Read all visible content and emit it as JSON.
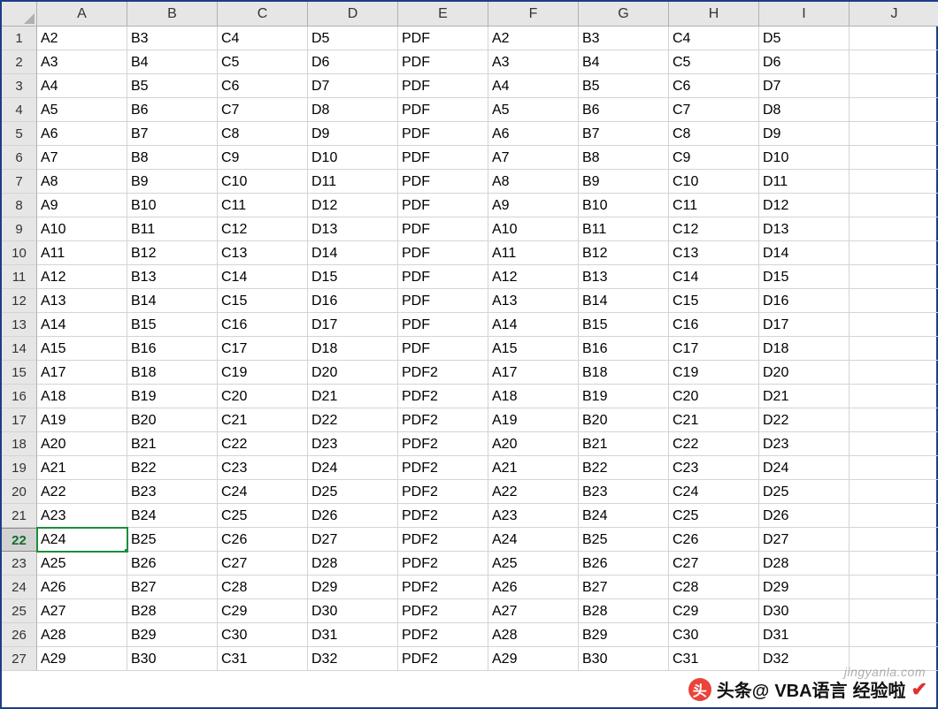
{
  "columns": [
    "A",
    "B",
    "C",
    "D",
    "E",
    "F",
    "G",
    "H",
    "I",
    "J"
  ],
  "row_numbers": [
    1,
    2,
    3,
    4,
    5,
    6,
    7,
    8,
    9,
    10,
    11,
    12,
    13,
    14,
    15,
    16,
    17,
    18,
    19,
    20,
    21,
    22,
    23,
    24,
    25,
    26,
    27
  ],
  "selected_row": 22,
  "selected_col": 0,
  "rows": [
    [
      "A2",
      "B3",
      "C4",
      "D5",
      "PDF",
      "A2",
      "B3",
      "C4",
      "D5",
      ""
    ],
    [
      "A3",
      "B4",
      "C5",
      "D6",
      "PDF",
      "A3",
      "B4",
      "C5",
      "D6",
      ""
    ],
    [
      "A4",
      "B5",
      "C6",
      "D7",
      "PDF",
      "A4",
      "B5",
      "C6",
      "D7",
      ""
    ],
    [
      "A5",
      "B6",
      "C7",
      "D8",
      "PDF",
      "A5",
      "B6",
      "C7",
      "D8",
      ""
    ],
    [
      "A6",
      "B7",
      "C8",
      "D9",
      "PDF",
      "A6",
      "B7",
      "C8",
      "D9",
      ""
    ],
    [
      "A7",
      "B8",
      "C9",
      "D10",
      "PDF",
      "A7",
      "B8",
      "C9",
      "D10",
      ""
    ],
    [
      "A8",
      "B9",
      "C10",
      "D11",
      "PDF",
      "A8",
      "B9",
      "C10",
      "D11",
      ""
    ],
    [
      "A9",
      "B10",
      "C11",
      "D12",
      "PDF",
      "A9",
      "B10",
      "C11",
      "D12",
      ""
    ],
    [
      "A10",
      "B11",
      "C12",
      "D13",
      "PDF",
      "A10",
      "B11",
      "C12",
      "D13",
      ""
    ],
    [
      "A11",
      "B12",
      "C13",
      "D14",
      "PDF",
      "A11",
      "B12",
      "C13",
      "D14",
      ""
    ],
    [
      "A12",
      "B13",
      "C14",
      "D15",
      "PDF",
      "A12",
      "B13",
      "C14",
      "D15",
      ""
    ],
    [
      "A13",
      "B14",
      "C15",
      "D16",
      "PDF",
      "A13",
      "B14",
      "C15",
      "D16",
      ""
    ],
    [
      "A14",
      "B15",
      "C16",
      "D17",
      "PDF",
      "A14",
      "B15",
      "C16",
      "D17",
      ""
    ],
    [
      "A15",
      "B16",
      "C17",
      "D18",
      "PDF",
      "A15",
      "B16",
      "C17",
      "D18",
      ""
    ],
    [
      "A17",
      "B18",
      "C19",
      "D20",
      "PDF2",
      "A17",
      "B18",
      "C19",
      "D20",
      ""
    ],
    [
      "A18",
      "B19",
      "C20",
      "D21",
      "PDF2",
      "A18",
      "B19",
      "C20",
      "D21",
      ""
    ],
    [
      "A19",
      "B20",
      "C21",
      "D22",
      "PDF2",
      "A19",
      "B20",
      "C21",
      "D22",
      ""
    ],
    [
      "A20",
      "B21",
      "C22",
      "D23",
      "PDF2",
      "A20",
      "B21",
      "C22",
      "D23",
      ""
    ],
    [
      "A21",
      "B22",
      "C23",
      "D24",
      "PDF2",
      "A21",
      "B22",
      "C23",
      "D24",
      ""
    ],
    [
      "A22",
      "B23",
      "C24",
      "D25",
      "PDF2",
      "A22",
      "B23",
      "C24",
      "D25",
      ""
    ],
    [
      "A23",
      "B24",
      "C25",
      "D26",
      "PDF2",
      "A23",
      "B24",
      "C25",
      "D26",
      ""
    ],
    [
      "A24",
      "B25",
      "C26",
      "D27",
      "PDF2",
      "A24",
      "B25",
      "C26",
      "D27",
      ""
    ],
    [
      "A25",
      "B26",
      "C27",
      "D28",
      "PDF2",
      "A25",
      "B26",
      "C27",
      "D28",
      ""
    ],
    [
      "A26",
      "B27",
      "C28",
      "D29",
      "PDF2",
      "A26",
      "B27",
      "C28",
      "D29",
      ""
    ],
    [
      "A27",
      "B28",
      "C29",
      "D30",
      "PDF2",
      "A27",
      "B28",
      "C29",
      "D30",
      ""
    ],
    [
      "A28",
      "B29",
      "C30",
      "D31",
      "PDF2",
      "A28",
      "B29",
      "C30",
      "D31",
      ""
    ],
    [
      "A29",
      "B30",
      "C31",
      "D32",
      "PDF2",
      "A29",
      "B30",
      "C31",
      "D32",
      ""
    ]
  ],
  "watermark": {
    "prefix": "头条@",
    "account": "VBA语言",
    "suffix": "经验啦",
    "site": "jingyanla.com"
  }
}
